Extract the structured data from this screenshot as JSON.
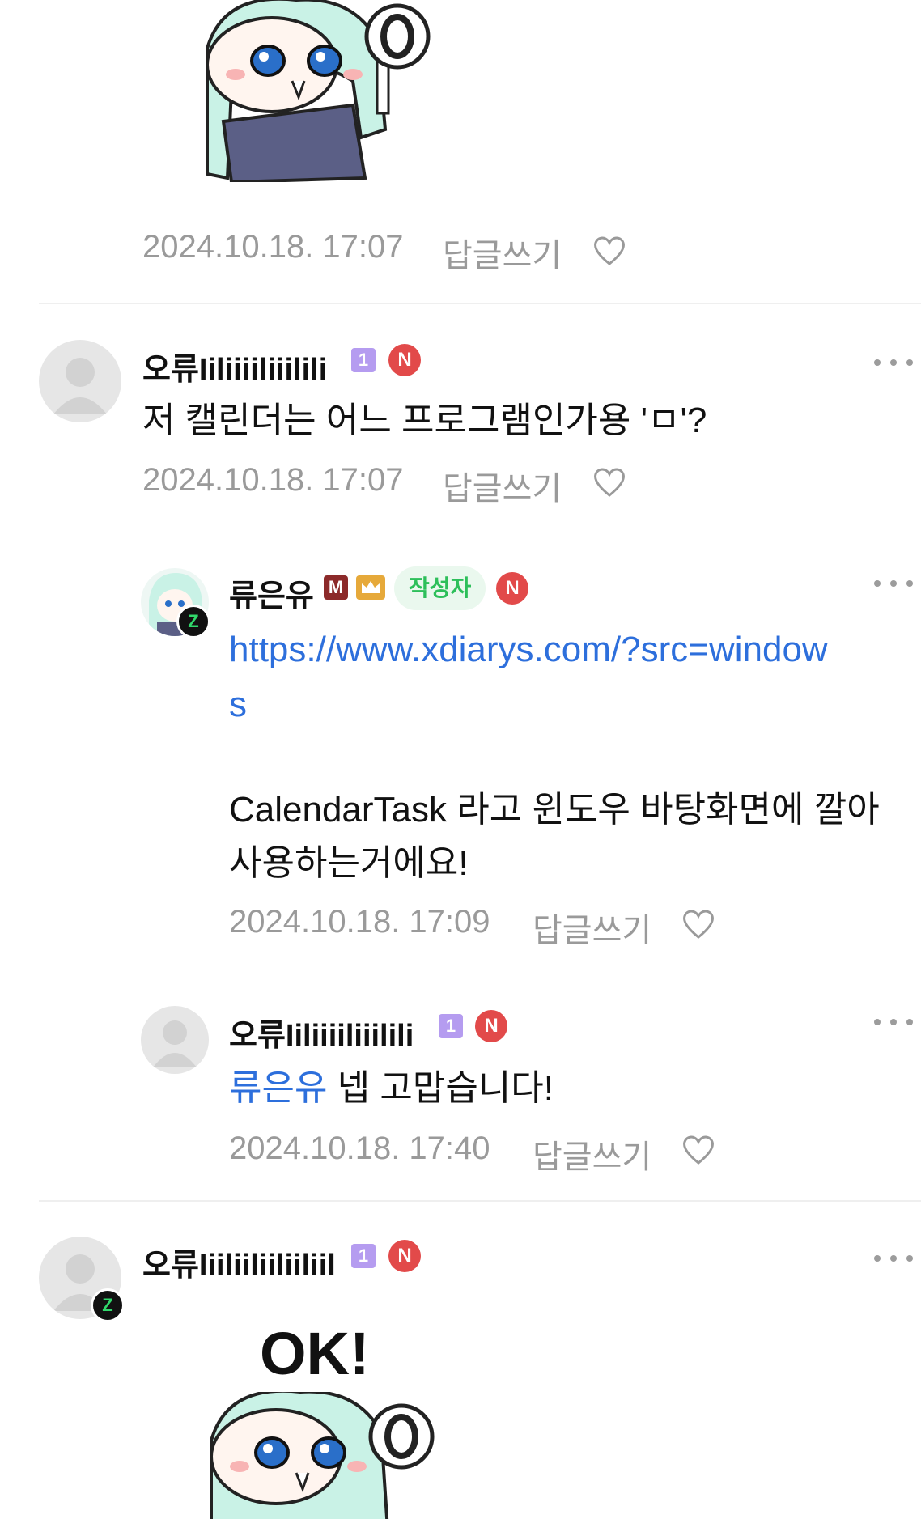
{
  "comments": [
    {
      "timestamp": "2024.10.18. 17:07",
      "reply_label": "답글쓰기"
    },
    {
      "author": "오류Iiliiiiliiilili",
      "level_badge": "1",
      "n_badge": "N",
      "text": "저 캘린더는 어느 프로그램인가용 'ㅁ'?",
      "timestamp": "2024.10.18. 17:07",
      "reply_label": "답글쓰기"
    },
    {
      "author": "류은유",
      "m_badge": "M",
      "author_tag": "작성자",
      "n_badge": "N",
      "link_line1": "https://www.xdiarys.com/?src=window",
      "link_line2": "s",
      "text_line1": "CalendarTask 라고 윈도우 바탕화면에 깔아",
      "text_line2": "사용하는거에요!",
      "timestamp": "2024.10.18. 17:09",
      "reply_label": "답글쓰기"
    },
    {
      "author": "오류Iiliiiiliiilili",
      "level_badge": "1",
      "n_badge": "N",
      "mention": "류은유",
      "text": " 넵 고맙습니다!",
      "timestamp": "2024.10.18. 17:40",
      "reply_label": "답글쓰기"
    },
    {
      "author": "오류Iiiliiliiliiliil",
      "level_badge": "1",
      "n_badge": "N",
      "sticker_text": "OK!"
    }
  ],
  "icons": {
    "heart": "heart-outline-icon",
    "more": "more-dots-icon",
    "z_badge": "z-badge-icon",
    "crown": "crown-icon"
  },
  "colors": {
    "link": "#2d6fdc",
    "meta": "#9a9a9a",
    "n_badge": "#e24a4a",
    "level_badge": "#b59cf0",
    "author_tag_bg": "#eaf8ee",
    "author_tag_text": "#2dbf5a"
  }
}
